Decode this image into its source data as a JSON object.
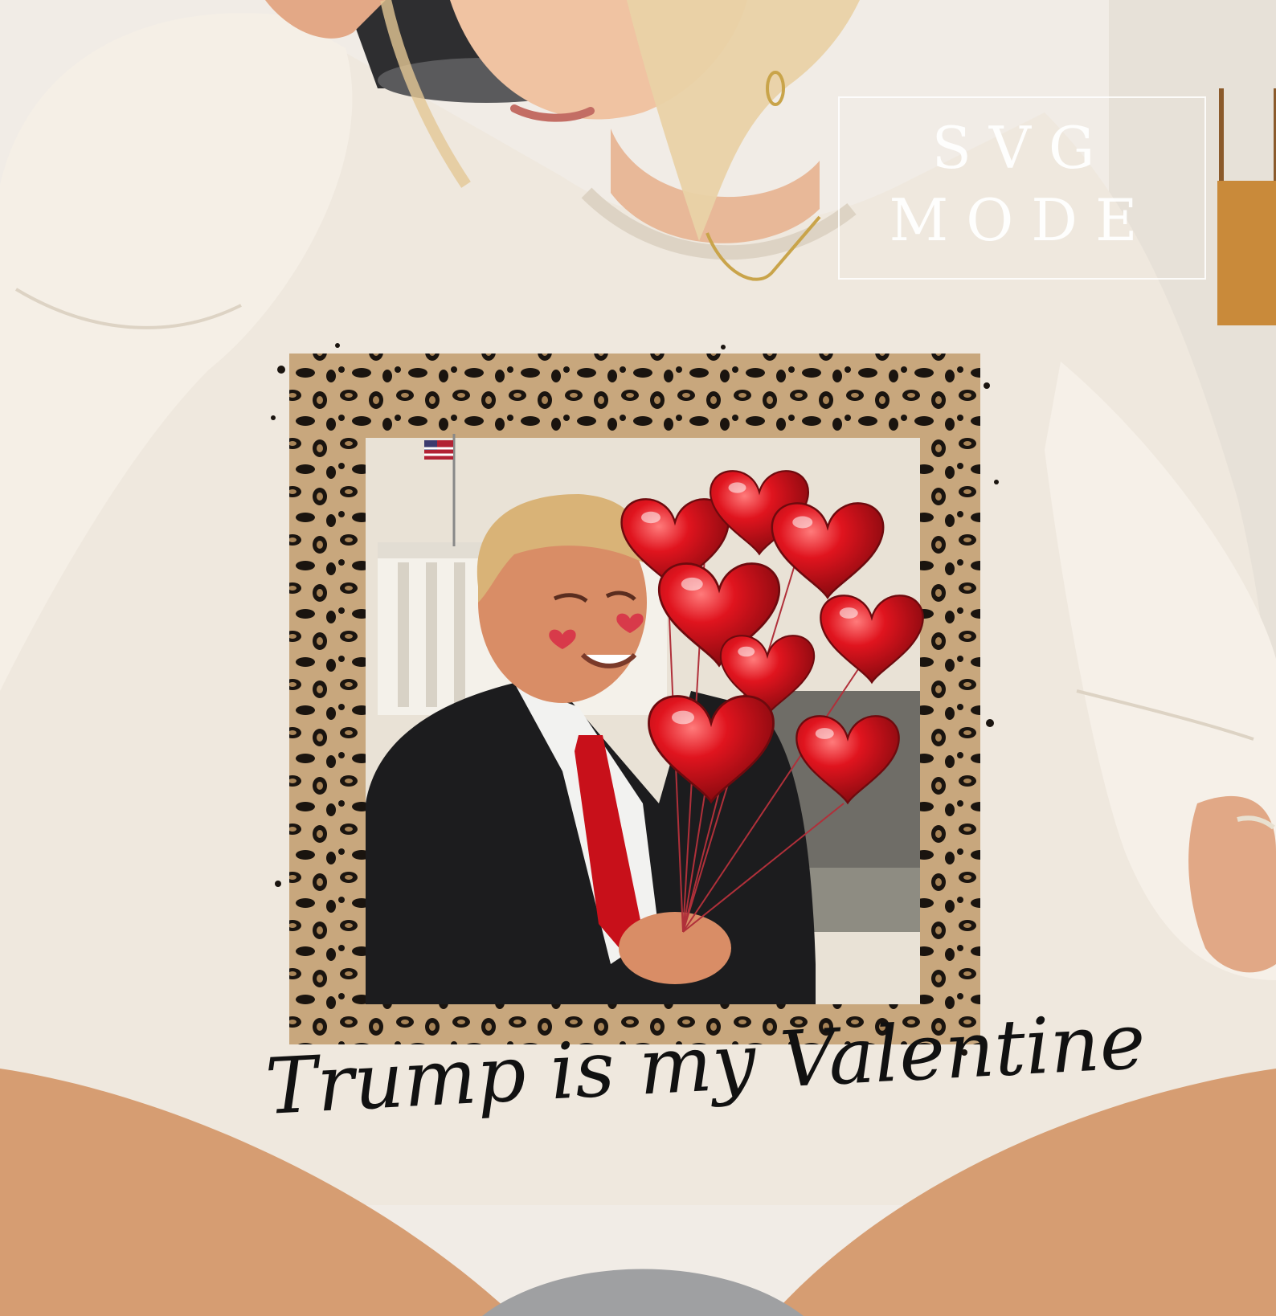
{
  "watermark": {
    "line1": "SVG",
    "line2": "MODE"
  },
  "design": {
    "caption": "Trump is my Valentine"
  },
  "colors": {
    "sweatshirt": "#efe8de",
    "leopard_base": "#c8a77d",
    "leopard_spot": "#1a140f",
    "balloon_red": "#d4121c",
    "suit": "#1c1c1e",
    "tie": "#c8101a",
    "skin": "#d98d66"
  }
}
